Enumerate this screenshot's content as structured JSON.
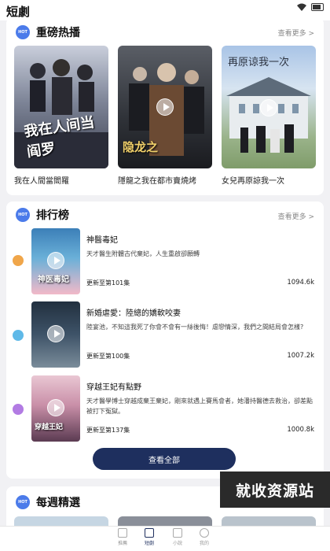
{
  "app": {
    "title": "短劇"
  },
  "hot": {
    "title": "重磅热播",
    "more": "查看更多 >",
    "items": [
      {
        "title": "我在人間當閻羅",
        "poster_text": "我在人间当阎罗"
      },
      {
        "title": "隱龍之我在都市賣燒烤",
        "poster_text": "隐龙之"
      },
      {
        "title": "女兒再原諒我一次",
        "poster_text": "再原谅我一次"
      }
    ]
  },
  "ranking": {
    "title": "排行榜",
    "more": "查看更多 >",
    "view_all": "查看全部",
    "items": [
      {
        "name": "神醫毒妃",
        "desc": "天才醫生附體古代棄妃，人生重啟卻願轉",
        "episodes": "更新至第101集",
        "views": "1094.6k",
        "badge_color": "#f0a64a",
        "poster_text": "神医毒妃"
      },
      {
        "name": "新婚虐愛：陸總的嬌軟咬妻",
        "desc": "陸宴池，不知這我死了你會不會有一絲後悔！虐戀情深，我們之間結局會怎樣?",
        "episodes": "更新至第100集",
        "views": "1007.2k",
        "badge_color": "#5fb9e8",
        "poster_text": ""
      },
      {
        "name": "穿越王妃有點野",
        "desc": "天才醫學博士穿越成棄王棄妃，剛來就遇上賽馬會者，她潘持醫德去救治，卻差點被打下冤獄。",
        "episodes": "更新至第137集",
        "views": "1000.8k",
        "badge_color": "#b27be3",
        "poster_text": "穿越王妃"
      }
    ]
  },
  "weekly": {
    "title": "每週精選"
  },
  "watermark": "就收资源站",
  "tabs": [
    {
      "label": "推薦",
      "icon": "recommend-icon"
    },
    {
      "label": "短劇",
      "icon": "short-drama-icon",
      "active": true
    },
    {
      "label": "小說",
      "icon": "novel-icon"
    },
    {
      "label": "我的",
      "icon": "profile-icon"
    }
  ],
  "colors": {
    "accent": "#1e2f5e",
    "hot_icon": "#4b7bea"
  }
}
